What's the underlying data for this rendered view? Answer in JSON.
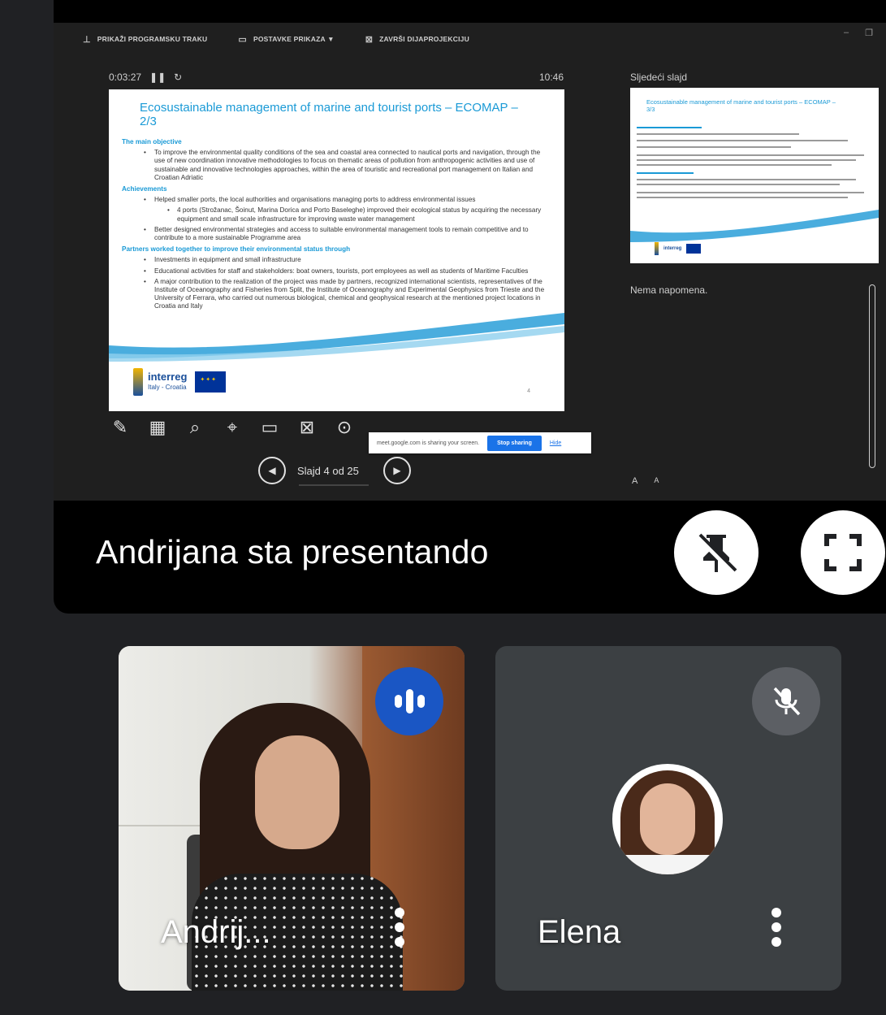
{
  "app": {
    "accent": "#1a73e8",
    "background": "#202124"
  },
  "presenter_view": {
    "toolbar": {
      "show_taskbar": "PRIKAŽI PROGRAMSKU TRAKU",
      "display_settings": "POSTAVKE PRIKAZA ▼",
      "end_show": "ZAVRŠI DIJAPROJEKCIJU"
    },
    "timer": "0:03:27",
    "clock": "10:46",
    "next_slide_label": "Sljedeći slajd",
    "notes": "Nema napomena.",
    "slide_counter": "Slajd 4 od 25",
    "font_increase": "A",
    "font_decrease": "A"
  },
  "slide": {
    "title": "Ecosustainable management of marine and tourist ports – ECOMAP – 2/3",
    "section1_heading": "The main objective",
    "section1_bullet1": "To improve the environmental quality conditions of the sea and coastal area connected to nautical ports and navigation, through the use of new coordination innovative methodologies to focus on thematic areas of pollution from anthropogenic activities and use of sustainable and innovative technologies approaches, within the area of touristic and recreational port management on Italian and Croatian Adriatic",
    "section2_heading": "Achievements",
    "section2_bullet1": "Helped smaller ports, the local authorities and organisations managing ports to address environmental issues",
    "section2_sub1": "4 ports (Strožanac, Šoinut, Marina Dorica and Porto Baseleghe) improved their ecological status by acquiring the necessary equipment and small scale infrastructure for improving waste water management",
    "section2_bullet2": "Better designed environmental strategies and access to suitable environmental management tools to remain competitive and to contribute to a more sustainable Programme area",
    "section3_heading": "Partners worked together to improve their environmental status through",
    "section3_bullet1": "Investments in equipment and small infrastructure",
    "section3_bullet2": "Educational activities for staff and stakeholders: boat owners, tourists, port employees as well as students of Maritime Faculties",
    "section3_bullet3": "A major contribution to the realization of the project was made by partners, recognized international scientists, representatives of the Institute of Oceanography and Fisheries from Split, the Institute of Oceanography and Experimental Geophysics from Trieste and the University of Ferrara, who carried out numerous biological, chemical and geophysical research at the mentioned project locations in Croatia and Italy",
    "logo_name": "interreg",
    "logo_sub": "Italy - Croatia",
    "page_number": "4"
  },
  "next_slide": {
    "title": "Ecosustainable management of marine and tourist ports – ECOMAP – 3/3"
  },
  "share_notice": {
    "text": "meet.google.com is sharing your screen.",
    "stop_label": "Stop sharing",
    "hide_label": "Hide"
  },
  "presenting_banner": "Andrijana sta presentando",
  "participants": [
    {
      "name": "Andrij...",
      "state": "speaking"
    },
    {
      "name": "Elena",
      "state": "muted"
    }
  ]
}
